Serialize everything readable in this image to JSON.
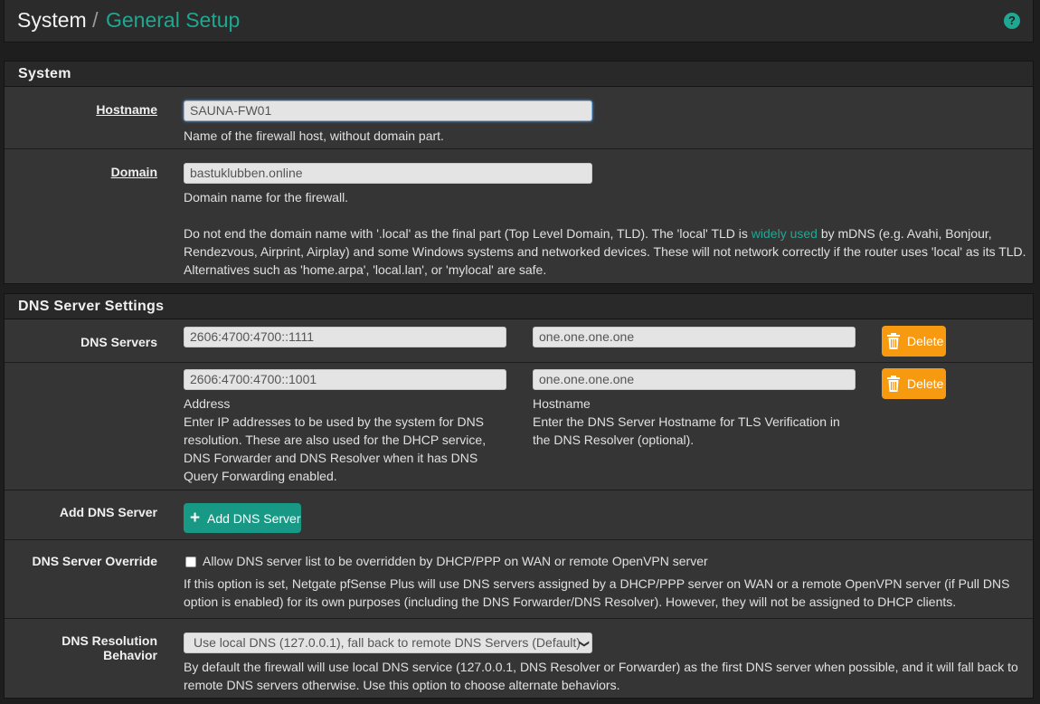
{
  "breadcrumb": {
    "section": "System",
    "separator": "/",
    "page": "General Setup"
  },
  "help_icon": {
    "glyph": "?"
  },
  "system_panel": {
    "title": "System",
    "hostname": {
      "label": "Hostname",
      "value": "SAUNA-FW01",
      "help": "Name of the firewall host, without domain part."
    },
    "domain": {
      "label": "Domain",
      "value": "bastuklubben.online",
      "help": "Domain name for the firewall.",
      "note_pre": "Do not end the domain name with '.local' as the final part (Top Level Domain, TLD). The 'local' TLD is ",
      "note_link": "widely used",
      "note_post": " by mDNS (e.g. Avahi, Bonjour, Rendezvous, Airprint, Airplay) and some Windows systems and networked devices. These will not network correctly if the router uses 'local' as its TLD. Alternatives such as 'home.arpa', 'local.lan', or 'mylocal' are safe."
    }
  },
  "dns_panel": {
    "title": "DNS Server Settings",
    "servers_label": "DNS Servers",
    "servers": [
      {
        "address": "2606:4700:4700::1111",
        "hostname": "one.one.one.one",
        "delete_label": "Delete"
      },
      {
        "address": "2606:4700:4700::1001",
        "hostname": "one.one.one.one",
        "delete_label": "Delete"
      }
    ],
    "address_caption": "Address",
    "address_help": "Enter IP addresses to be used by the system for DNS resolution. These are also used for the DHCP service, DNS Forwarder and DNS Resolver when it has DNS Query Forwarding enabled.",
    "hostname_caption": "Hostname",
    "hostname_help": "Enter the DNS Server Hostname for TLS Verification in the DNS Resolver (optional).",
    "add_label": "Add DNS Server",
    "add_button": "Add DNS Server",
    "override": {
      "label": "DNS Server Override",
      "checkbox_label": "Allow DNS server list to be overridden by DHCP/PPP on WAN or remote OpenVPN server",
      "checked": false,
      "help": "If this option is set, Netgate pfSense Plus will use DNS servers assigned by a DHCP/PPP server on WAN or a remote OpenVPN server (if Pull DNS option is enabled) for its own purposes (including the DNS Forwarder/DNS Resolver). However, they will not be assigned to DHCP clients."
    },
    "resolution": {
      "label": "DNS Resolution Behavior",
      "selected": "Use local DNS (127.0.0.1), fall back to remote DNS Servers (Default)",
      "help": "By default the firewall will use local DNS service (127.0.0.1, DNS Resolver or Forwarder) as the first DNS server when possible, and it will fall back to remote DNS servers otherwise. Use this option to choose alternate behaviors."
    }
  },
  "colors": {
    "accent": "#1ea892",
    "delete": "#f79a10",
    "add": "#189985"
  }
}
